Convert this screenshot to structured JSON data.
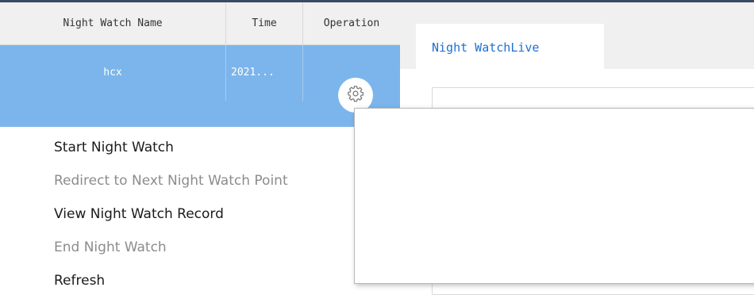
{
  "table": {
    "columns": [
      "Night Watch Name",
      "Time",
      "Operation"
    ],
    "rows": [
      {
        "name": "hcx",
        "time": "2021..."
      }
    ]
  },
  "panel": {
    "tab_label": "Night WatchLive"
  },
  "context_menu": {
    "items": [
      {
        "label": "Start Night Watch",
        "enabled": true
      },
      {
        "label": "Redirect to Next Night Watch Point",
        "enabled": false
      },
      {
        "label": "View Night Watch Record",
        "enabled": true
      },
      {
        "label": "End Night Watch",
        "enabled": false
      },
      {
        "label": "Refresh",
        "enabled": true
      }
    ]
  },
  "icons": {
    "operation": "gear-icon"
  },
  "colors": {
    "selected_row": "#7cb5ec",
    "tab_text": "#1f6fd1",
    "header_bg": "#f0f0f0"
  }
}
